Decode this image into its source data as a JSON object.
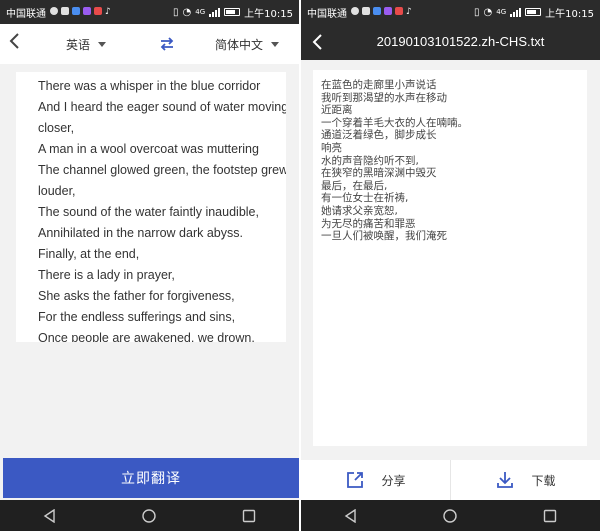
{
  "colors": {
    "status_bar": "#2b2b2b",
    "accent_blue": "#3b59c3",
    "nav_bar": "#202020",
    "page_bg": "#f2f2f2"
  },
  "status_bar": {
    "carrier": "中国联通",
    "network": "4G",
    "time": "上午10:15",
    "icons": [
      "wechat-icon",
      "video-icon",
      "browser-icon",
      "message-icon",
      "music-icon",
      "tiktok-icon",
      "vibrate-icon",
      "wifi-icon",
      "signal-icon",
      "battery-icon"
    ]
  },
  "left": {
    "header": {
      "back_icon": "chevron-left-icon",
      "source_lang": "英语",
      "swap_icon": "swap-arrows-icon",
      "target_lang": "简体中文"
    },
    "source_text": [
      "There was a whisper in the blue corridor",
      "And I heard the eager sound of water moving",
      "closer,",
      "A man in a wool overcoat was muttering",
      "The channel glowed green, the footstep grew",
      "louder,",
      "The sound of the water faintly inaudible,",
      "Annihilated in the narrow dark abyss.",
      "Finally, at the end,",
      "There is a lady in prayer,",
      "She asks the father for forgiveness,",
      "For the endless sufferings and sins,",
      "Once people are awakened, we drown."
    ],
    "translate_button": "立即翻译"
  },
  "right": {
    "header": {
      "back_icon": "chevron-left-icon",
      "file_name": "20190103101522.zh-CHS.txt"
    },
    "result_text": [
      "在蓝色的走廊里小声说话",
      "我听到那渴望的水声在移动",
      "近距离",
      "一个穿着羊毛大衣的人在喃喃。",
      "通道泛着绿色，脚步成长",
      "响亮",
      "水的声音隐约听不到,",
      "在狭窄的黑暗深渊中毁灭",
      "最后，在最后,",
      "有一位女士在祈祷,",
      "她请求父亲宽恕,",
      "为无尽的痛苦和罪恶",
      "一旦人们被唤醒，我们淹死"
    ],
    "actions": {
      "share_label": "分享",
      "share_icon": "share-icon",
      "download_label": "下载",
      "download_icon": "download-icon"
    }
  },
  "nav_bar": {
    "icons": [
      "nav-back-icon",
      "nav-home-icon",
      "nav-recents-icon"
    ]
  }
}
